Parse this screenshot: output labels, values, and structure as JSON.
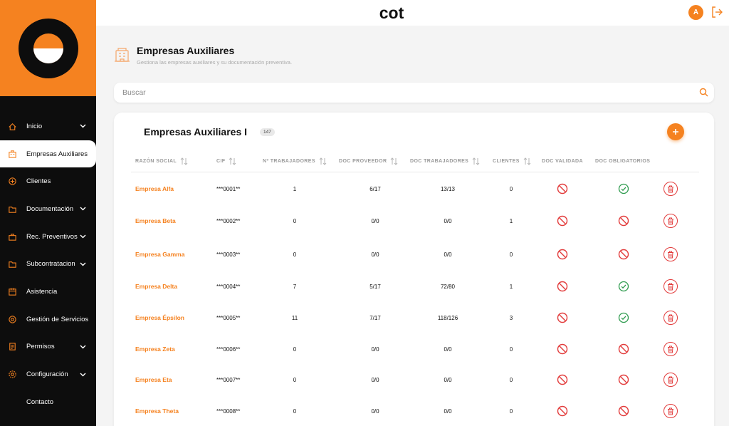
{
  "brand": "cot",
  "user": {
    "initial": "A"
  },
  "sidebar": {
    "items": [
      {
        "label": "Inicio",
        "icon": "home-icon",
        "chevron": true,
        "active": false
      },
      {
        "label": "Empresas Auxiliares",
        "icon": "company-icon",
        "chevron": false,
        "active": true
      },
      {
        "label": "Clientes",
        "icon": "clients-icon",
        "chevron": false,
        "active": false
      },
      {
        "label": "Documentación",
        "icon": "folder-icon",
        "chevron": true,
        "active": false
      },
      {
        "label": "Rec. Preventivos",
        "icon": "briefcase-icon",
        "chevron": true,
        "active": false
      },
      {
        "label": "Subcontratacion",
        "icon": "folder-icon",
        "chevron": true,
        "active": false
      },
      {
        "label": "Asistencia",
        "icon": "attendance-icon",
        "chevron": false,
        "active": false
      },
      {
        "label": "Gestión de Servicios",
        "icon": "services-icon",
        "chevron": false,
        "active": false
      },
      {
        "label": "Permisos",
        "icon": "permissions-icon",
        "chevron": true,
        "active": false
      },
      {
        "label": "Configuración",
        "icon": "gear-icon",
        "chevron": true,
        "active": false
      },
      {
        "label": "Contacto",
        "icon": "",
        "chevron": false,
        "active": false
      }
    ]
  },
  "page": {
    "title": "Empresas Auxiliares",
    "subtitle": "Gestiona las empresas auxiliares y su documentación preventiva."
  },
  "search": {
    "placeholder": "Buscar"
  },
  "table": {
    "title": "Empresas Auxiliares I",
    "count": "147",
    "headers": [
      "RAZÓN SOCIAL",
      "CIF",
      "Nº TRABAJADORES",
      "DOC PROVEEDOR",
      "DOC TRABAJADORES",
      "CLIENTES",
      "DOC VALIDADA",
      "DOC OBLIGATORIOS"
    ],
    "rows": [
      {
        "name": "Empresa Alfa",
        "cif": "***0001**",
        "workers": "1",
        "doc_prov": "6/17",
        "doc_trab": "13/13",
        "clients": "0",
        "validada": "no",
        "obligatorios": "ok"
      },
      {
        "name": "Empresa Beta",
        "cif": "***0002**",
        "workers": "0",
        "doc_prov": "0/0",
        "doc_trab": "0/0",
        "clients": "1",
        "validada": "no",
        "obligatorios": "no"
      },
      {
        "name": "Empresa Gamma",
        "cif": "***0003**",
        "workers": "0",
        "doc_prov": "0/0",
        "doc_trab": "0/0",
        "clients": "0",
        "validada": "no",
        "obligatorios": "no"
      },
      {
        "name": "Empresa Delta",
        "cif": "***0004**",
        "workers": "7",
        "doc_prov": "5/17",
        "doc_trab": "72/80",
        "clients": "1",
        "validada": "no",
        "obligatorios": "ok"
      },
      {
        "name": "Empresa Épsilon",
        "cif": "***0005**",
        "workers": "11",
        "doc_prov": "7/17",
        "doc_trab": "118/126",
        "clients": "3",
        "validada": "no",
        "obligatorios": "ok"
      },
      {
        "name": "Empresa Zeta",
        "cif": "***0006**",
        "workers": "0",
        "doc_prov": "0/0",
        "doc_trab": "0/0",
        "clients": "0",
        "validada": "no",
        "obligatorios": "no"
      },
      {
        "name": "Empresa Eta",
        "cif": "***0007**",
        "workers": "0",
        "doc_prov": "0/0",
        "doc_trab": "0/0",
        "clients": "0",
        "validada": "no",
        "obligatorios": "no"
      },
      {
        "name": "Empresa Theta",
        "cif": "***0008**",
        "workers": "0",
        "doc_prov": "0/0",
        "doc_trab": "0/0",
        "clients": "0",
        "validada": "no",
        "obligatorios": "no"
      }
    ]
  },
  "colors": {
    "accent": "#f58220",
    "sidebar": "#0d0d0d",
    "ok": "#2e9b4e",
    "no": "#e23b3b"
  }
}
